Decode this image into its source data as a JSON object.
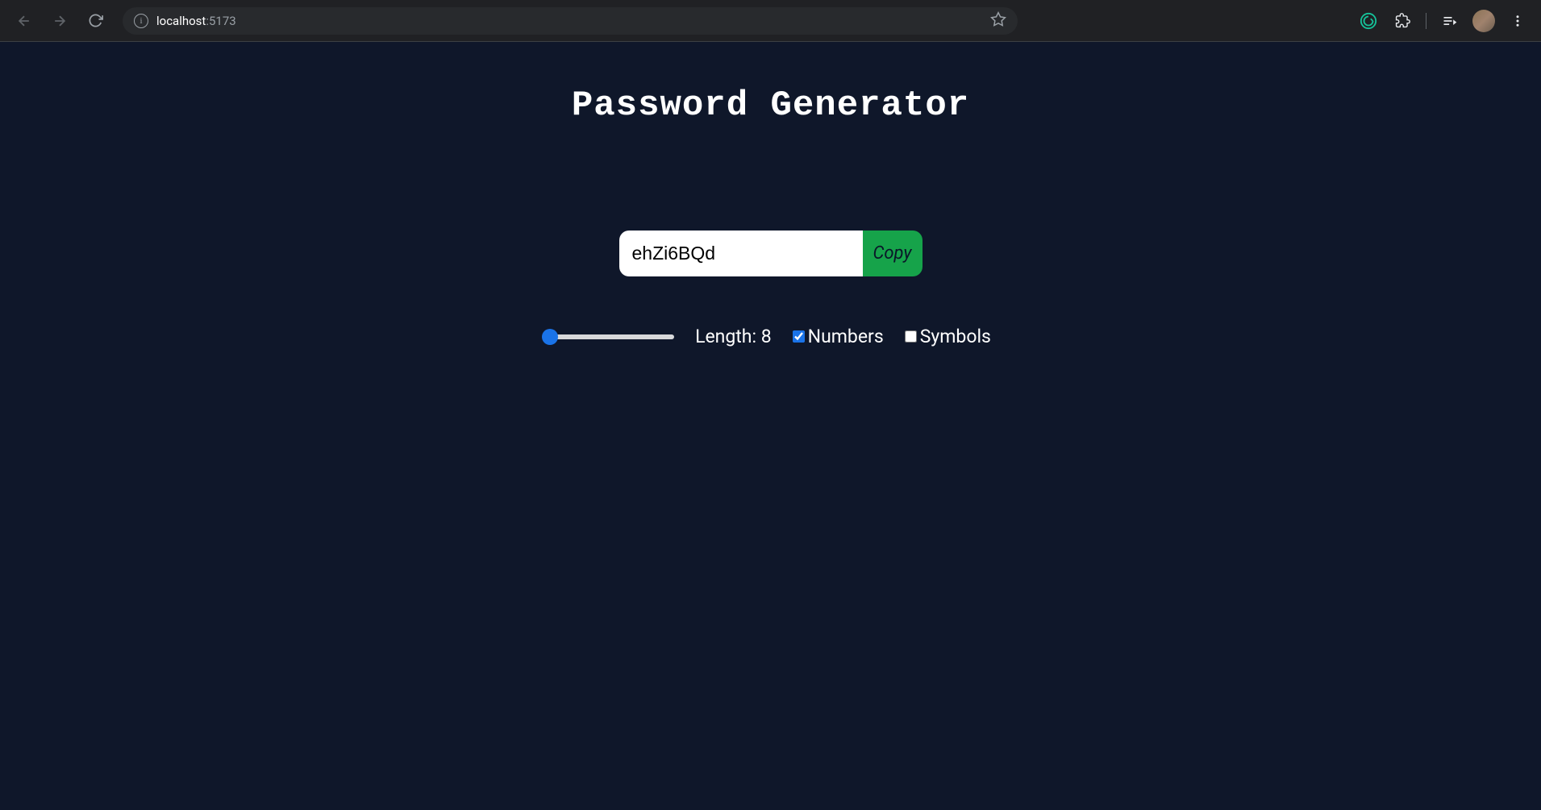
{
  "browser": {
    "url_host": "localhost",
    "url_port": ":5173"
  },
  "page": {
    "title": "Password Generator",
    "password_value": "ehZi6BQd",
    "copy_label": "Copy",
    "length_label_prefix": "Length: ",
    "length_value": "8",
    "slider_min": "8",
    "slider_max": "100",
    "slider_value": "8",
    "numbers_label": "Numbers",
    "numbers_checked": true,
    "symbols_label": "Symbols",
    "symbols_checked": false
  }
}
